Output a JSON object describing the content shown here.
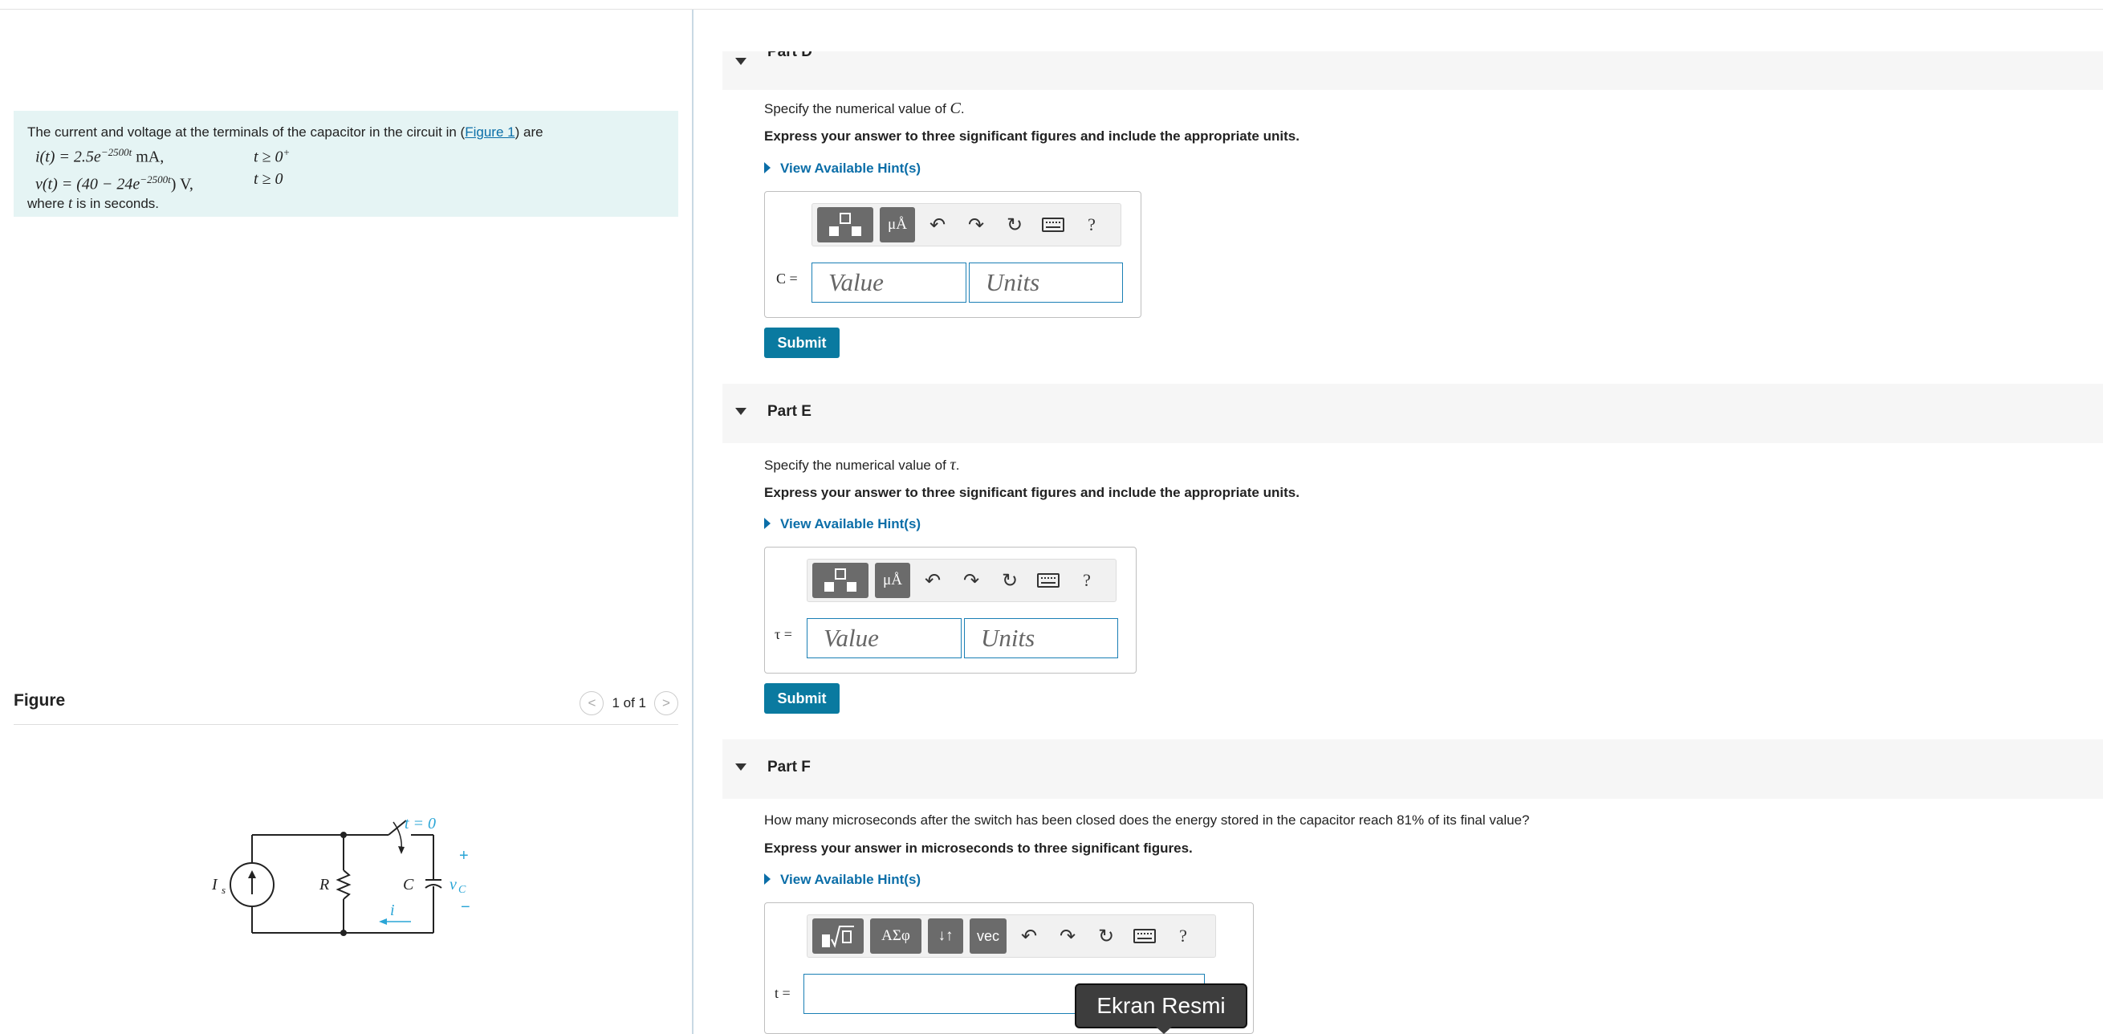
{
  "problem": {
    "text_before": "The current and voltage at the terminals of the capacitor in the circuit in (",
    "link": "Figure 1",
    "text_after": ") are",
    "eq1": "i(t) = 2.5e",
    "eq1_exp": "−2500t",
    "eq1_unit": " mA,",
    "cond1": "t ≥ 0",
    "cond1_sup": "+",
    "eq2": "v(t) = (40 − 24e",
    "eq2_exp": "−2500t",
    "eq2_unit": ") V,",
    "cond2": "t ≥ 0",
    "footer_before": "where ",
    "footer_var": "t",
    "footer_after": " is in seconds."
  },
  "figure": {
    "title": "Figure",
    "pager": "1 of 1",
    "prev": "<",
    "next": ">",
    "labels": {
      "source": "I",
      "source_sub": "s",
      "resistor": "R",
      "capacitor": "C",
      "switch": "t = 0",
      "plus": "+",
      "minus": "−",
      "vc": "v",
      "vc_sub": "C",
      "current": "i"
    }
  },
  "parts": {
    "d": {
      "title": "Part D",
      "question_before": "Specify the numerical value of ",
      "question_var": "C",
      "question_after": ".",
      "instruction": "Express your answer to three significant figures and include the appropriate units.",
      "hint": "View Available Hint(s)",
      "input_label": "C =",
      "value_placeholder": "Value",
      "units_placeholder": "Units",
      "submit": "Submit"
    },
    "e": {
      "title": "Part E",
      "question_before": "Specify the numerical value of ",
      "question_var": "τ",
      "question_after": ".",
      "instruction": "Express your answer to three significant figures and include the appropriate units.",
      "hint": "View Available Hint(s)",
      "input_label": "τ =",
      "value_placeholder": "Value",
      "units_placeholder": "Units",
      "submit": "Submit"
    },
    "f": {
      "title": "Part F",
      "question": "How many microseconds after the switch has been closed does the energy stored in the capacitor reach 81% of its final value?",
      "instruction": "Express your answer in microseconds to three significant figures.",
      "hint": "View Available Hint(s)",
      "input_label": "t =",
      "greek_btn": "ΑΣφ",
      "arrows_btn": "↓↑",
      "vec_btn": "vec"
    }
  },
  "toolbar": {
    "units_btn": "μÅ",
    "help": "?"
  },
  "tooltip": "Ekran Resmi"
}
